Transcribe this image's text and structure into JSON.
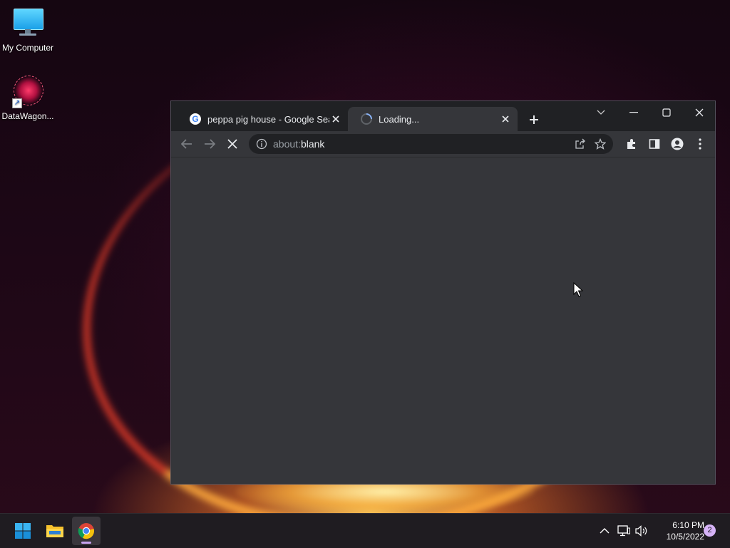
{
  "desktop": {
    "icons": [
      {
        "label": "My Computer",
        "icon": "monitor-icon"
      },
      {
        "label": "DataWagon...",
        "icon": "datawagon-icon"
      }
    ]
  },
  "browser": {
    "tabs": [
      {
        "title": "peppa pig house - Google Search",
        "favicon": "google-icon",
        "state": "inactive"
      },
      {
        "title": "Loading...",
        "favicon": "loading-spinner-icon",
        "state": "active"
      }
    ],
    "address_bar": {
      "scheme": "about:",
      "host": "blank"
    },
    "toolbar_icons": [
      "back-icon",
      "forward-icon",
      "stop-icon",
      "info-icon",
      "share-icon",
      "bookmark-star-icon",
      "extensions-icon",
      "side-panel-icon",
      "profile-icon",
      "menu-icon"
    ],
    "window_controls": [
      "tab-search-icon",
      "minimize-icon",
      "maximize-icon",
      "close-icon"
    ]
  },
  "taskbar": {
    "apps": [
      {
        "name": "start",
        "icon": "windows-start-icon"
      },
      {
        "name": "file-explorer",
        "icon": "folder-icon"
      },
      {
        "name": "chrome",
        "icon": "chrome-icon",
        "active": true
      }
    ],
    "tray_icons": [
      "chevron-up-icon",
      "network-icon",
      "volume-icon"
    ],
    "clock": {
      "time": "6:10 PM",
      "date": "10/5/2022"
    },
    "notifications": "2"
  },
  "colors": {
    "browser_frame": "#202124",
    "browser_toolbar": "#35363a",
    "omnibox": "#202124",
    "taskbar": "#1f1c21",
    "accent": "#c7a3f0"
  }
}
